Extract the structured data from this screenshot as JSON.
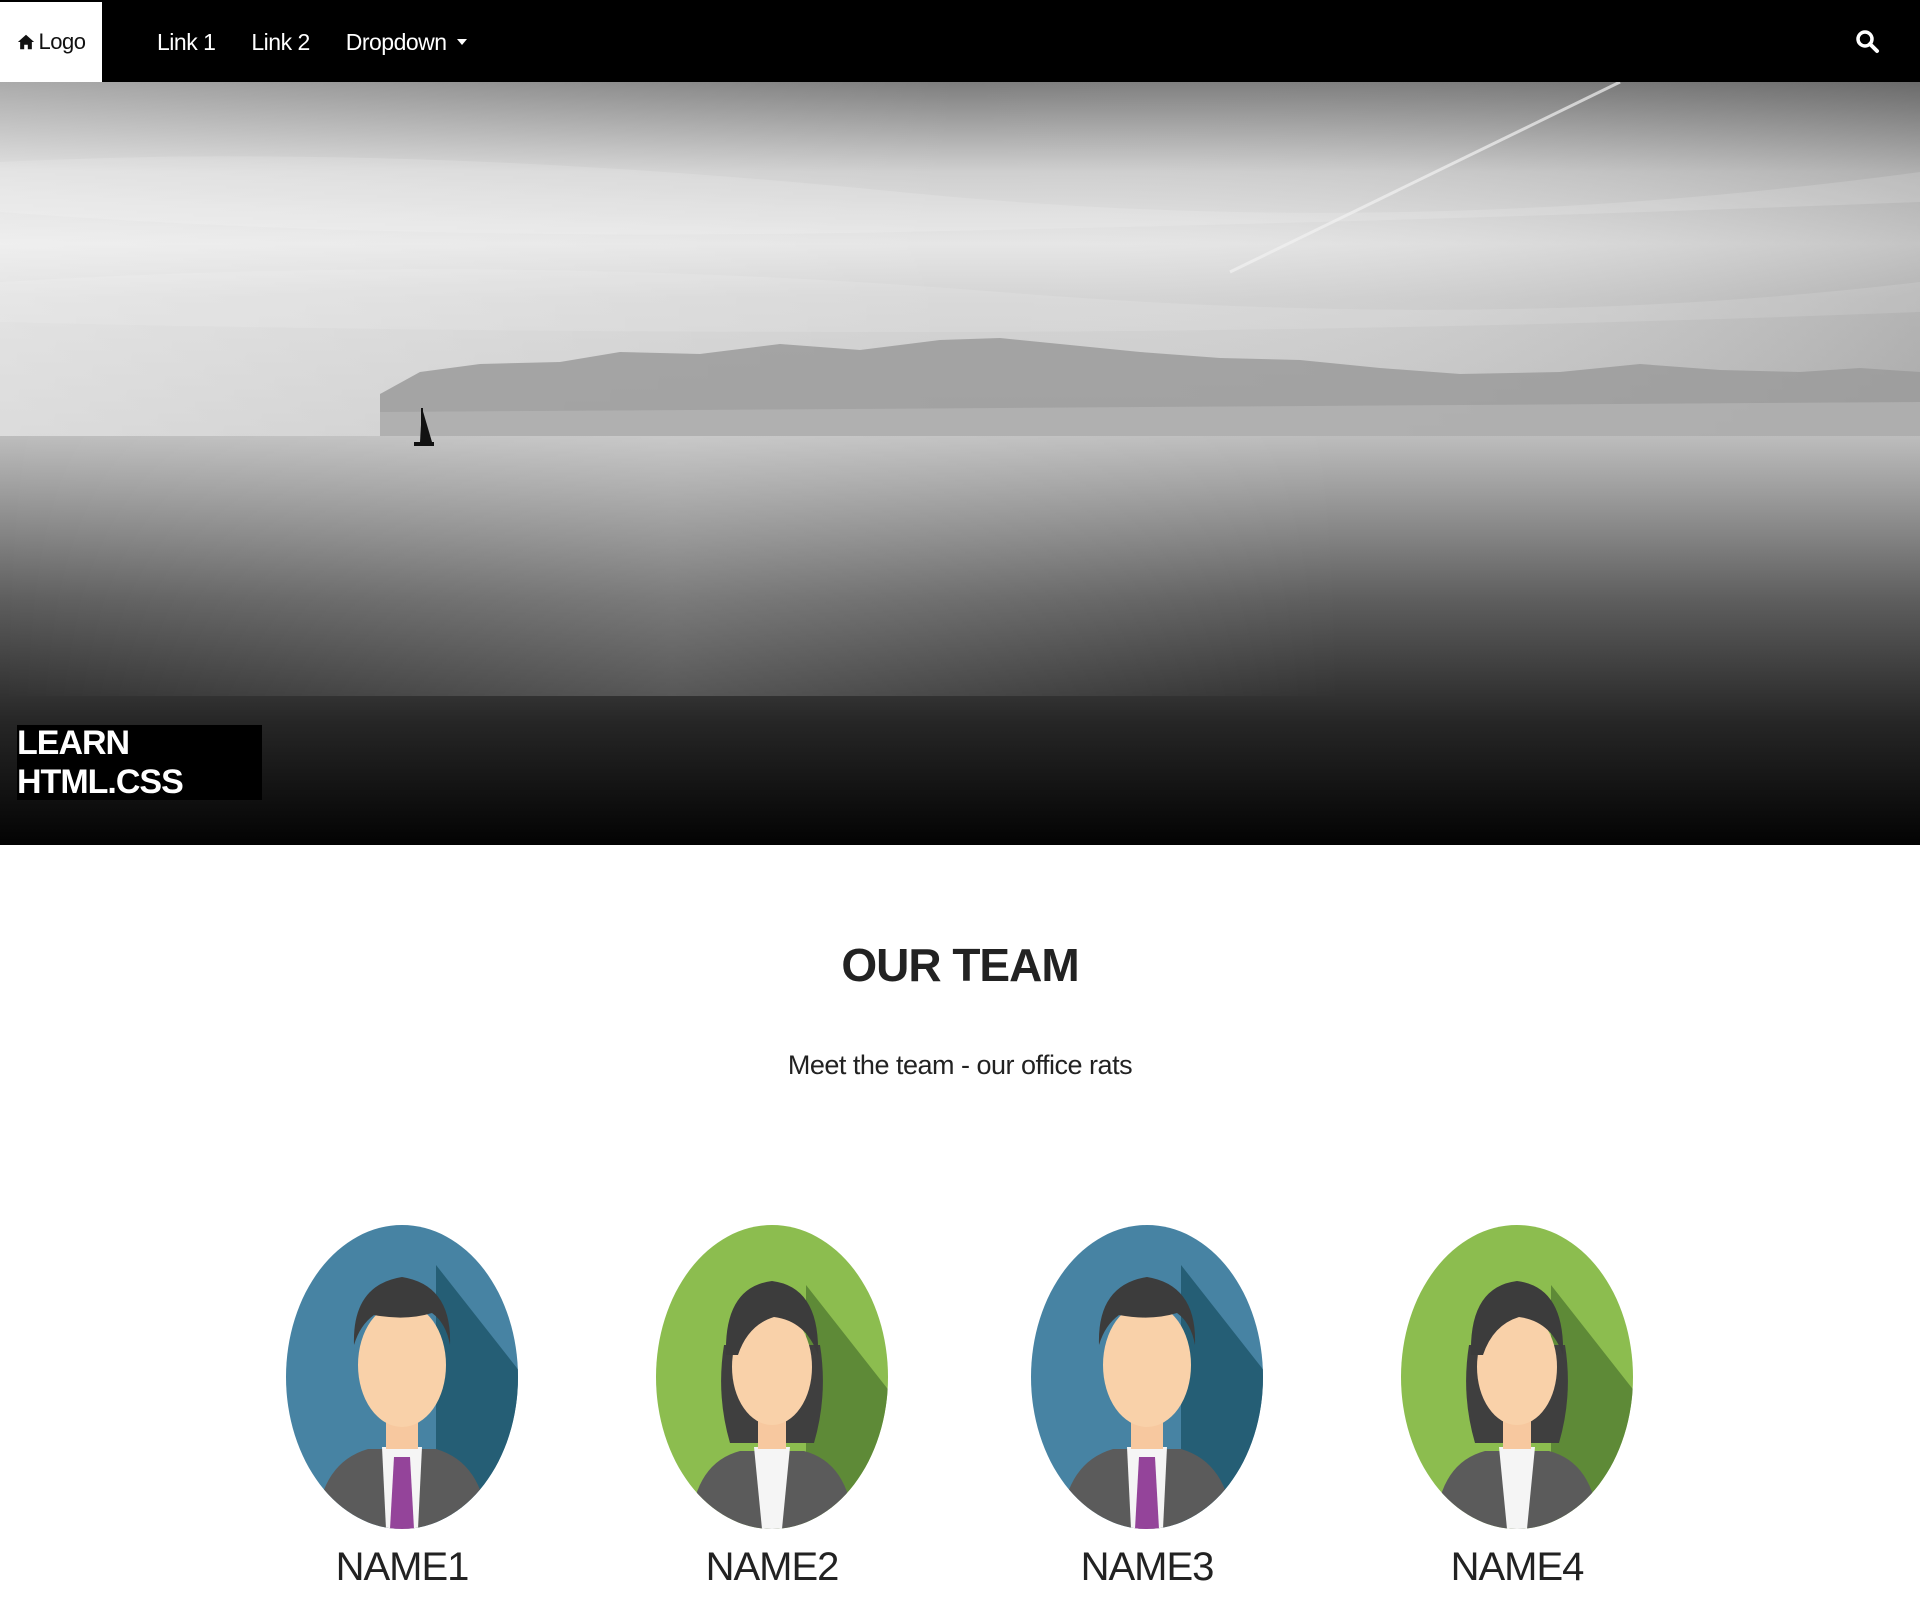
{
  "navbar": {
    "logo_label": "Logo",
    "links": [
      "Link 1",
      "Link 2"
    ],
    "dropdown_label": "Dropdown"
  },
  "hero": {
    "caption": "LEARN HTML.CSS"
  },
  "team": {
    "title": "OUR TEAM",
    "subtitle": "Meet the team - our office rats",
    "members": [
      {
        "name": "NAME1",
        "avatar": "male-avatar-icon",
        "color": "#3f7f9c"
      },
      {
        "name": "NAME2",
        "avatar": "female-avatar-icon",
        "color": "#86b84a"
      },
      {
        "name": "NAME3",
        "avatar": "male-avatar-icon",
        "color": "#3f7f9c"
      },
      {
        "name": "NAME4",
        "avatar": "female-avatar-icon",
        "color": "#86b84a"
      }
    ]
  }
}
